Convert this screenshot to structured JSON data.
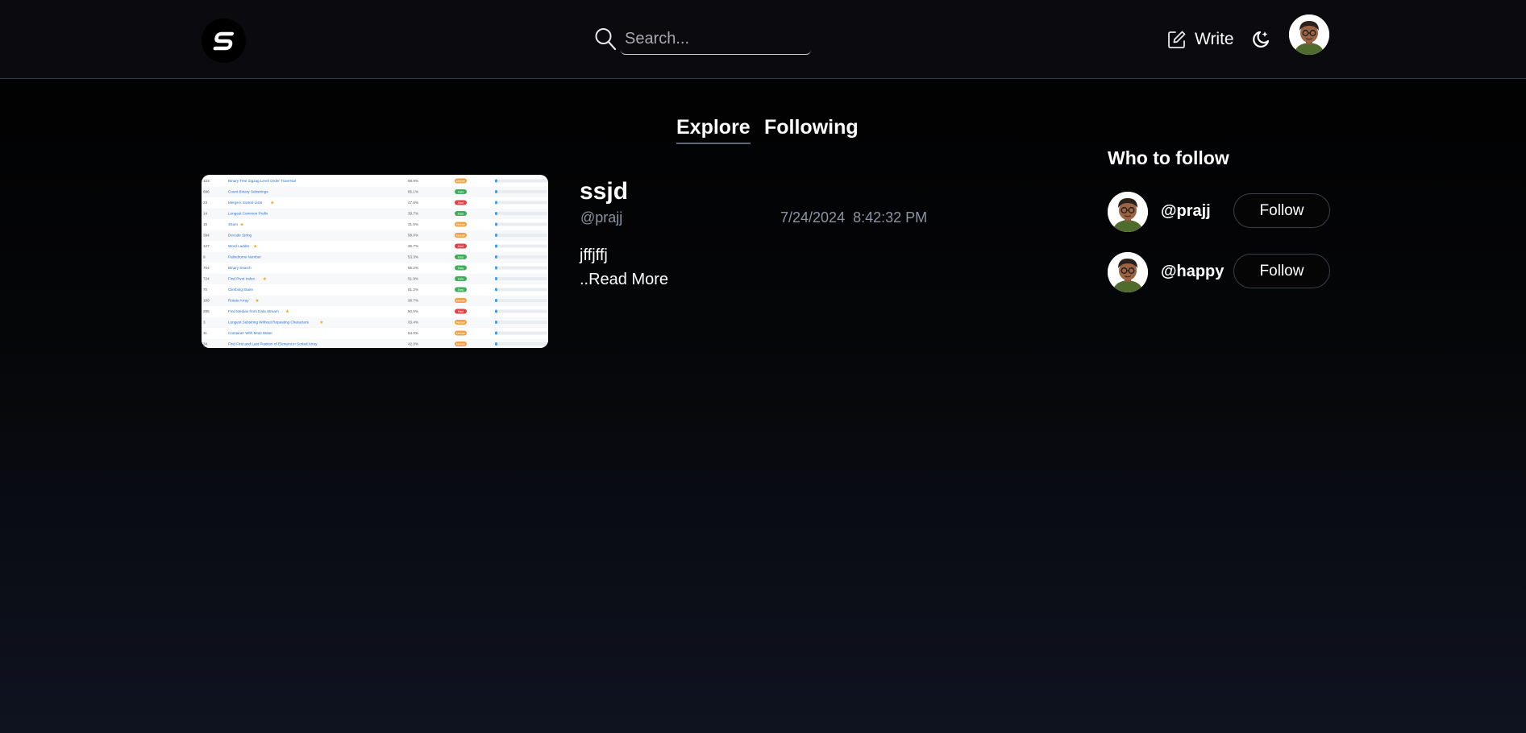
{
  "header": {
    "logo_icon": "s-logo-icon",
    "search": {
      "placeholder": "Search..."
    },
    "write_label": "Write",
    "theme_icon": "moon-sparkle-icon",
    "avatar_icon": "user-avatar-icon"
  },
  "tabs": [
    {
      "label": "Explore",
      "active": true
    },
    {
      "label": "Following",
      "active": false
    }
  ],
  "post": {
    "title": "ssjd",
    "author": "@prajj",
    "date": "7/24/2024",
    "time": "8:42:32 PM",
    "excerpt": "jffjffj",
    "read_more": "..Read More",
    "thumbnail": {
      "rows": [
        {
          "num": "103",
          "title": "Binary Tree Zigzag Level Order Traversal",
          "rate": "59.9%",
          "diff": "Medium",
          "color": "#f0a040",
          "star": false
        },
        {
          "num": "696",
          "title": "Count Binary Substrings",
          "rate": "65.1%",
          "diff": "Easy",
          "color": "#3fae5b",
          "star": false
        },
        {
          "num": "23",
          "title": "Merge k Sorted Lists",
          "rate": "47.6%",
          "diff": "Hard",
          "color": "#e0424a",
          "star": true
        },
        {
          "num": "14",
          "title": "Longest Common Prefix",
          "rate": "39.7%",
          "diff": "Easy",
          "color": "#3fae5b",
          "star": false
        },
        {
          "num": "15",
          "title": "3Sum",
          "rate": "31.5%",
          "diff": "Medium",
          "color": "#f0a040",
          "star": true
        },
        {
          "num": "394",
          "title": "Decode String",
          "rate": "58.0%",
          "diff": "Medium",
          "color": "#f0a040",
          "star": false
        },
        {
          "num": "127",
          "title": "Word Ladder",
          "rate": "35.7%",
          "diff": "Hard",
          "color": "#e0424a",
          "star": true
        },
        {
          "num": "9",
          "title": "Palindrome Number",
          "rate": "53.3%",
          "diff": "Easy",
          "color": "#3fae5b",
          "star": false
        },
        {
          "num": "704",
          "title": "Binary Search",
          "rate": "55.2%",
          "diff": "Easy",
          "color": "#3fae5b",
          "star": false
        },
        {
          "num": "724",
          "title": "Find Pivot Index",
          "rate": "51.9%",
          "diff": "Easy",
          "color": "#3fae5b",
          "star": true
        },
        {
          "num": "70",
          "title": "Climbing Stairs",
          "rate": "51.2%",
          "diff": "Easy",
          "color": "#3fae5b",
          "star": false
        },
        {
          "num": "189",
          "title": "Rotate Array",
          "rate": "38.7%",
          "diff": "Medium",
          "color": "#f0a040",
          "star": true
        },
        {
          "num": "295",
          "title": "Find Median from Data Stream",
          "rate": "50.5%",
          "diff": "Hard",
          "color": "#e0424a",
          "star": true
        },
        {
          "num": "3",
          "title": "Longest Substring Without Repeating Characters",
          "rate": "33.4%",
          "diff": "Medium",
          "color": "#f0a040",
          "star": true
        },
        {
          "num": "11",
          "title": "Container With Most Water",
          "rate": "54.0%",
          "diff": "Medium",
          "color": "#f0a040",
          "star": false
        },
        {
          "num": "34",
          "title": "Find First and Last Position of Element in Sorted Array",
          "rate": "42.0%",
          "diff": "Medium",
          "color": "#f0a040",
          "star": false
        }
      ]
    }
  },
  "who_to_follow": {
    "heading": "Who to follow",
    "users": [
      {
        "handle": "@prajj",
        "button": "Follow",
        "avatar_icon": "user-avatar-icon"
      },
      {
        "handle": "@happy",
        "button": "Follow",
        "avatar_icon": "user-avatar-icon"
      }
    ]
  },
  "colors": {
    "background_top": "#000000",
    "background_bottom": "#0f1320",
    "header_bg": "#0b0b0f",
    "muted_text": "#8c93a3"
  }
}
